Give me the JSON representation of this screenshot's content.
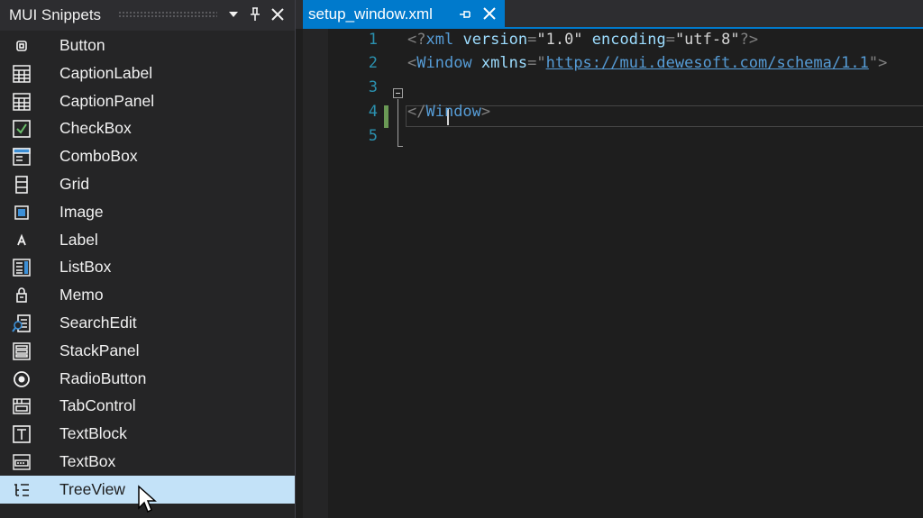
{
  "panel": {
    "title": "MUI Snippets",
    "items": [
      {
        "label": "Button",
        "icon": "button-icon"
      },
      {
        "label": "CaptionLabel",
        "icon": "caption-label-icon"
      },
      {
        "label": "CaptionPanel",
        "icon": "caption-panel-icon"
      },
      {
        "label": "CheckBox",
        "icon": "checkbox-icon"
      },
      {
        "label": "ComboBox",
        "icon": "combobox-icon"
      },
      {
        "label": "Grid",
        "icon": "grid-icon"
      },
      {
        "label": "Image",
        "icon": "image-icon"
      },
      {
        "label": "Label",
        "icon": "label-icon"
      },
      {
        "label": "ListBox",
        "icon": "listbox-icon"
      },
      {
        "label": "Memo",
        "icon": "memo-icon"
      },
      {
        "label": "SearchEdit",
        "icon": "search-edit-icon"
      },
      {
        "label": "StackPanel",
        "icon": "stack-panel-icon"
      },
      {
        "label": "RadioButton",
        "icon": "radio-button-icon"
      },
      {
        "label": "TabControl",
        "icon": "tab-control-icon"
      },
      {
        "label": "TextBlock",
        "icon": "text-block-icon"
      },
      {
        "label": "TextBox",
        "icon": "text-box-icon"
      },
      {
        "label": "TreeView",
        "icon": "tree-view-icon",
        "selected": true
      }
    ]
  },
  "editor": {
    "tab_title": "setup_window.xml",
    "line_numbers": [
      "1",
      "2",
      "3",
      "4",
      "5"
    ],
    "code": {
      "l1_open": "<?",
      "l1_name": "xml",
      "l1_attr1": "version",
      "l1_eq1": "=",
      "l1_val1": "\"1.0\"",
      "l1_attr2": "encoding",
      "l1_eq2": "=",
      "l1_val2": "\"utf-8\"",
      "l1_close": "?>",
      "l2_open": "<",
      "l2_name": "Window",
      "l2_attr": "xmlns",
      "l2_eq": "=",
      "l2_quote_open": "\"",
      "l2_url": "https://mui.dewesoft.com/schema/1.1",
      "l2_quote_close": "\">",
      "l4_open": "</",
      "l4_name": "Window",
      "l4_close": ">"
    }
  },
  "colors": {
    "accent": "#007acc",
    "selection": "#c3e2f8",
    "line_number": "#2b91af",
    "xml_name": "#569cd6",
    "xml_attr": "#9cdcfe",
    "change_marker": "#6a9955"
  }
}
